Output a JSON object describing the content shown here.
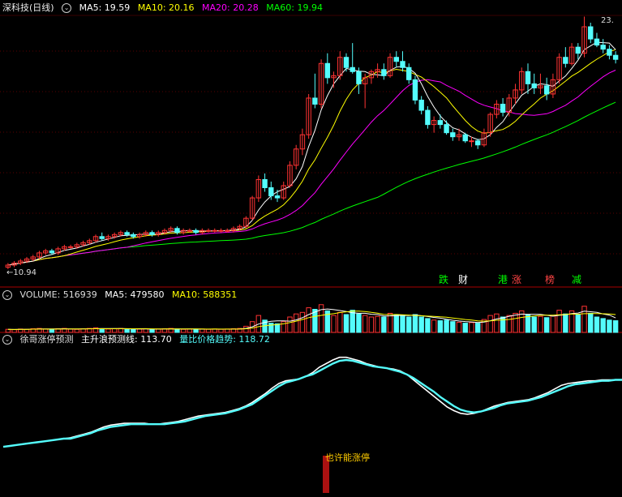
{
  "main": {
    "name": "深科技(日线)",
    "ma5_label": "MA5: 19.59",
    "ma10_label": "MA10: 20.16",
    "ma20_label": "MA20: 20.28",
    "ma60_label": "MA60: 19.94",
    "low_label": "10.94",
    "high_label": "23.",
    "colors": {
      "ma5": "#ffffff",
      "ma10": "#ffff00",
      "ma20": "#ff00ff",
      "ma60": "#00ff00",
      "up": "#ff3333",
      "down": "#54fcfc"
    }
  },
  "badges": [
    {
      "text": "跌",
      "color": "#00ff00"
    },
    {
      "text": "财",
      "color": "#ffffff"
    },
    {
      "text": "港",
      "color": "#00ff00"
    },
    {
      "text": "涨",
      "color": "#ff4444"
    },
    {
      "text": "榜",
      "color": "#ff4444"
    },
    {
      "text": "减",
      "color": "#00ff00"
    }
  ],
  "volume_panel": {
    "label": "VOLUME: 516939",
    "ma5_label": "MA5: 479580",
    "ma10_label": "MA10: 588351"
  },
  "indicator_panel": {
    "name": "徐哥涨停预测",
    "line1_label": "主升浪预测线: 113.70",
    "line2_label": "量比价格趋势: 118.72",
    "annotation": "也许能涨停"
  },
  "chart_data": {
    "type": "candlestick",
    "price_range": [
      10.94,
      23.0
    ],
    "candles": [
      [
        11.0,
        11.2,
        10.9,
        11.1
      ],
      [
        11.1,
        11.3,
        11.0,
        11.2
      ],
      [
        11.2,
        11.4,
        11.1,
        11.3
      ],
      [
        11.3,
        11.5,
        11.2,
        11.4
      ],
      [
        11.4,
        11.6,
        11.3,
        11.5
      ],
      [
        11.5,
        11.8,
        11.4,
        11.7
      ],
      [
        11.7,
        11.9,
        11.6,
        11.8
      ],
      [
        11.8,
        11.9,
        11.6,
        11.7
      ],
      [
        11.7,
        12.0,
        11.6,
        11.9
      ],
      [
        11.9,
        12.1,
        11.8,
        12.0
      ],
      [
        12.0,
        12.1,
        11.9,
        12.0
      ],
      [
        12.0,
        12.2,
        11.9,
        12.1
      ],
      [
        12.1,
        12.3,
        12.0,
        12.2
      ],
      [
        12.2,
        12.4,
        12.1,
        12.3
      ],
      [
        12.3,
        12.6,
        12.2,
        12.5
      ],
      [
        12.5,
        12.7,
        12.3,
        12.4
      ],
      [
        12.4,
        12.6,
        12.3,
        12.5
      ],
      [
        12.5,
        12.7,
        12.4,
        12.6
      ],
      [
        12.6,
        12.8,
        12.5,
        12.7
      ],
      [
        12.7,
        12.8,
        12.5,
        12.6
      ],
      [
        12.6,
        12.7,
        12.4,
        12.5
      ],
      [
        12.5,
        12.7,
        12.4,
        12.6
      ],
      [
        12.6,
        12.8,
        12.5,
        12.7
      ],
      [
        12.7,
        12.8,
        12.5,
        12.6
      ],
      [
        12.6,
        12.8,
        12.5,
        12.7
      ],
      [
        12.7,
        12.9,
        12.6,
        12.8
      ],
      [
        12.8,
        13.0,
        12.7,
        12.9
      ],
      [
        12.9,
        13.0,
        12.6,
        12.7
      ],
      [
        12.7,
        12.9,
        12.6,
        12.8
      ],
      [
        12.8,
        12.9,
        12.7,
        12.8
      ],
      [
        12.8,
        12.9,
        12.6,
        12.7
      ],
      [
        12.7,
        12.9,
        12.6,
        12.8
      ],
      [
        12.8,
        12.9,
        12.7,
        12.8
      ],
      [
        12.8,
        12.9,
        12.7,
        12.8
      ],
      [
        12.8,
        12.9,
        12.7,
        12.8
      ],
      [
        12.8,
        12.9,
        12.7,
        12.8
      ],
      [
        12.8,
        13.0,
        12.7,
        12.9
      ],
      [
        12.9,
        13.1,
        12.8,
        13.0
      ],
      [
        13.0,
        13.5,
        12.9,
        13.4
      ],
      [
        13.4,
        14.5,
        13.3,
        14.4
      ],
      [
        14.4,
        15.5,
        14.2,
        15.3
      ],
      [
        15.3,
        15.6,
        14.7,
        14.9
      ],
      [
        14.9,
        15.2,
        14.3,
        14.5
      ],
      [
        14.5,
        14.8,
        14.2,
        14.4
      ],
      [
        14.4,
        15.2,
        14.3,
        15.0
      ],
      [
        15.0,
        16.2,
        14.9,
        16.0
      ],
      [
        16.0,
        17.0,
        15.8,
        16.8
      ],
      [
        16.8,
        17.8,
        16.5,
        17.5
      ],
      [
        17.5,
        19.5,
        17.3,
        19.3
      ],
      [
        19.3,
        20.5,
        18.8,
        19.0
      ],
      [
        19.0,
        21.2,
        18.8,
        21.0
      ],
      [
        21.0,
        21.5,
        20.0,
        20.3
      ],
      [
        20.3,
        20.6,
        19.8,
        20.4
      ],
      [
        20.4,
        21.6,
        20.2,
        21.3
      ],
      [
        21.3,
        21.5,
        20.6,
        20.8
      ],
      [
        20.8,
        22.0,
        20.5,
        20.6
      ],
      [
        20.6,
        20.8,
        19.5,
        20.0
      ],
      [
        20.0,
        20.5,
        18.8,
        20.3
      ],
      [
        20.3,
        20.7,
        20.0,
        20.6
      ],
      [
        20.6,
        21.0,
        20.3,
        20.7
      ],
      [
        20.7,
        21.0,
        20.2,
        20.4
      ],
      [
        20.4,
        21.5,
        20.3,
        21.3
      ],
      [
        21.3,
        21.6,
        20.8,
        21.1
      ],
      [
        21.1,
        21.6,
        20.6,
        20.8
      ],
      [
        20.8,
        21.0,
        20.0,
        20.2
      ],
      [
        20.2,
        20.4,
        19.0,
        19.2
      ],
      [
        19.2,
        19.4,
        18.5,
        18.7
      ],
      [
        18.7,
        18.9,
        17.8,
        18.0
      ],
      [
        18.0,
        18.4,
        17.6,
        18.2
      ],
      [
        18.2,
        18.5,
        17.8,
        18.0
      ],
      [
        18.0,
        18.2,
        17.5,
        17.6
      ],
      [
        17.6,
        17.8,
        17.2,
        17.4
      ],
      [
        17.4,
        17.8,
        17.2,
        17.5
      ],
      [
        17.5,
        17.6,
        17.1,
        17.2
      ],
      [
        17.2,
        17.4,
        16.9,
        17.2
      ],
      [
        17.2,
        17.3,
        16.8,
        17.0
      ],
      [
        17.0,
        17.8,
        16.9,
        17.6
      ],
      [
        17.6,
        18.6,
        17.4,
        18.5
      ],
      [
        18.5,
        19.2,
        18.3,
        19.0
      ],
      [
        19.0,
        19.3,
        18.4,
        18.6
      ],
      [
        18.6,
        19.5,
        18.4,
        19.3
      ],
      [
        19.3,
        20.0,
        19.0,
        19.7
      ],
      [
        19.7,
        20.8,
        19.5,
        20.6
      ],
      [
        20.6,
        21.0,
        19.5,
        20.0
      ],
      [
        20.0,
        20.5,
        19.5,
        19.8
      ],
      [
        19.8,
        20.5,
        19.5,
        19.9
      ],
      [
        19.9,
        20.3,
        19.2,
        19.5
      ],
      [
        19.5,
        20.5,
        19.3,
        20.2
      ],
      [
        20.2,
        21.5,
        20.0,
        21.3
      ],
      [
        21.3,
        21.8,
        20.8,
        21.0
      ],
      [
        21.0,
        22.0,
        20.9,
        21.8
      ],
      [
        21.8,
        22.0,
        21.2,
        21.5
      ],
      [
        21.5,
        23.3,
        21.3,
        22.8
      ],
      [
        22.8,
        23.0,
        22.0,
        22.2
      ],
      [
        22.2,
        22.5,
        21.8,
        21.9
      ],
      [
        21.9,
        22.2,
        21.5,
        21.7
      ],
      [
        21.7,
        21.9,
        21.2,
        21.4
      ],
      [
        21.4,
        21.6,
        21.0,
        21.2
      ]
    ],
    "volume": [
      0.1,
      0.09,
      0.11,
      0.1,
      0.12,
      0.13,
      0.11,
      0.1,
      0.12,
      0.13,
      0.11,
      0.1,
      0.12,
      0.13,
      0.15,
      0.12,
      0.11,
      0.12,
      0.13,
      0.11,
      0.1,
      0.11,
      0.12,
      0.1,
      0.11,
      0.12,
      0.13,
      0.11,
      0.1,
      0.11,
      0.1,
      0.11,
      0.1,
      0.11,
      0.1,
      0.11,
      0.12,
      0.13,
      0.2,
      0.35,
      0.55,
      0.4,
      0.3,
      0.28,
      0.35,
      0.5,
      0.6,
      0.65,
      0.8,
      0.75,
      0.9,
      0.7,
      0.55,
      0.65,
      0.58,
      0.72,
      0.6,
      0.55,
      0.5,
      0.52,
      0.5,
      0.62,
      0.58,
      0.55,
      0.5,
      0.58,
      0.5,
      0.45,
      0.4,
      0.38,
      0.4,
      0.35,
      0.33,
      0.3,
      0.32,
      0.3,
      0.42,
      0.55,
      0.6,
      0.5,
      0.55,
      0.62,
      0.7,
      0.58,
      0.5,
      0.52,
      0.48,
      0.55,
      0.72,
      0.6,
      0.7,
      0.58,
      0.85,
      0.62,
      0.5,
      0.45,
      0.4,
      0.38
    ],
    "indicator_range": [
      0,
      130
    ],
    "indicator_line1": [
      8,
      9,
      10,
      11,
      12,
      13,
      14,
      15,
      16,
      17,
      18,
      20,
      22,
      24,
      27,
      30,
      32,
      33,
      34,
      34,
      34,
      34,
      33,
      33,
      34,
      35,
      36,
      38,
      40,
      42,
      43,
      44,
      45,
      46,
      48,
      50,
      53,
      57,
      62,
      67,
      73,
      78,
      81,
      82,
      83,
      86,
      90,
      96,
      100,
      104,
      107,
      107,
      105,
      103,
      100,
      98,
      96,
      95,
      94,
      92,
      88,
      82,
      76,
      70,
      64,
      58,
      52,
      48,
      45,
      44,
      45,
      47,
      50,
      53,
      55,
      57,
      58,
      59,
      60,
      62,
      65,
      68,
      72,
      76,
      78,
      79,
      80,
      81,
      81,
      82,
      82,
      82,
      82
    ],
    "indicator_line2": [
      8,
      9,
      10,
      11,
      12,
      13,
      14,
      15,
      16,
      17,
      17,
      19,
      21,
      23,
      26,
      28,
      30,
      31,
      32,
      33,
      33,
      33,
      33,
      33,
      33,
      34,
      35,
      36,
      38,
      40,
      42,
      43,
      44,
      45,
      47,
      49,
      52,
      55,
      60,
      65,
      70,
      75,
      79,
      81,
      83,
      86,
      88,
      92,
      96,
      100,
      103,
      104,
      103,
      101,
      99,
      97,
      96,
      95,
      93,
      91,
      88,
      84,
      79,
      74,
      69,
      63,
      58,
      53,
      49,
      47,
      46,
      47,
      49,
      51,
      54,
      56,
      57,
      58,
      59,
      61,
      63,
      66,
      69,
      72,
      75,
      77,
      78,
      79,
      80,
      81,
      81,
      82,
      82
    ]
  }
}
